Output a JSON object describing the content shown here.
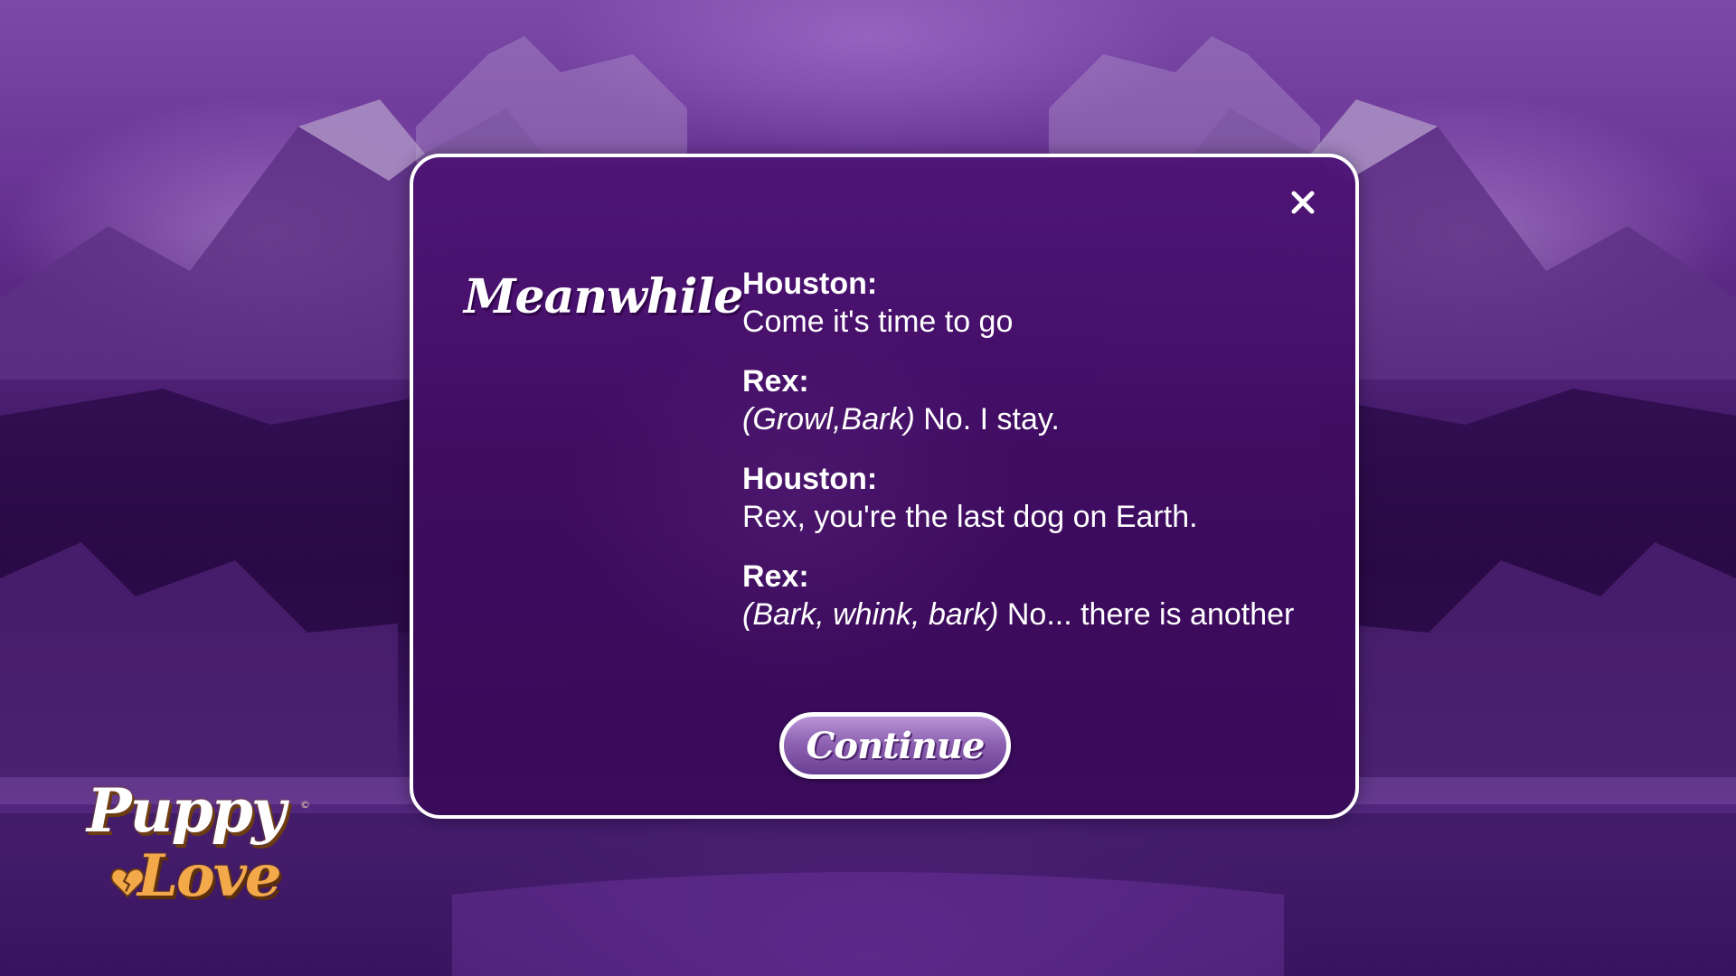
{
  "heading": "Meanwhile",
  "dialogue": [
    {
      "speaker": "Houston:",
      "action": "",
      "text": "Come it's time to go"
    },
    {
      "speaker": "Rex:",
      "action": "(Growl,Bark)",
      "text": " No. I stay."
    },
    {
      "speaker": "Houston:",
      "action": "",
      "text": "Rex, you're the last dog on Earth."
    },
    {
      "speaker": "Rex:",
      "action": "(Bark, whink, bark)",
      "text": " No... there is another"
    }
  ],
  "buttons": {
    "continue_label": "Continue",
    "close_icon": "close-icon"
  },
  "logo": {
    "line1": "Puppy",
    "line2": "Love",
    "copyright": "©",
    "heart_icon": "broken-heart-icon"
  },
  "colors": {
    "dialog_bg": "#4e1476",
    "border": "#ffffff",
    "button_fill": "#8e63b3",
    "logo_orange": "#f3a94a"
  }
}
